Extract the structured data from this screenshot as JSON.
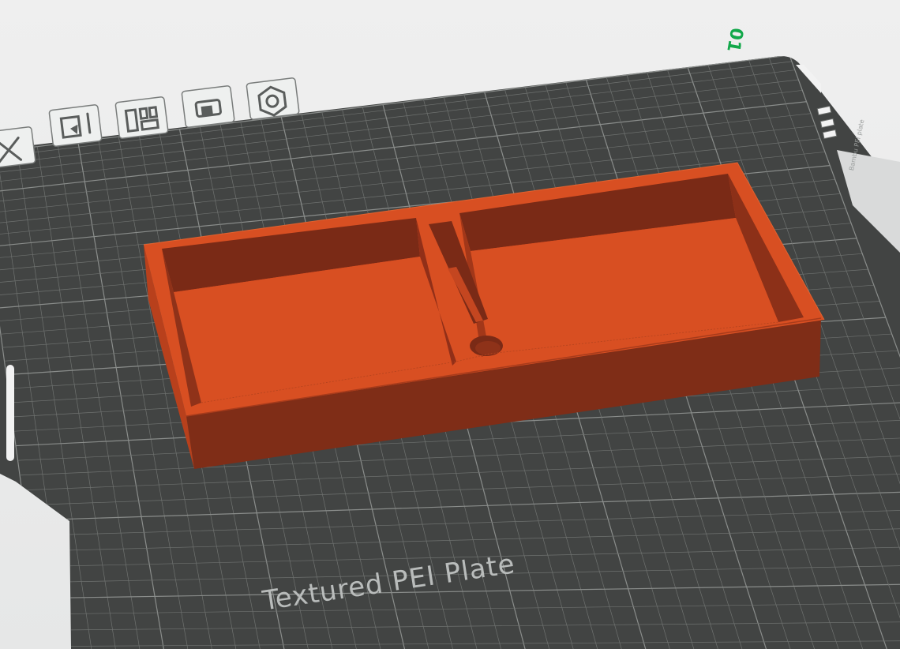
{
  "viewport": {
    "plate_name": "Textured PEI Plate",
    "plate_index": "01",
    "side_tab_text": "Bambu PEI plate"
  },
  "plate_toolbar": [
    {
      "id": "close",
      "label": "Close",
      "icon": "close-icon"
    },
    {
      "id": "select",
      "label": "Select plate",
      "icon": "plate-select-icon"
    },
    {
      "id": "arrange",
      "label": "Arrange",
      "icon": "arrange-icon"
    },
    {
      "id": "lock",
      "label": "Lock",
      "icon": "lock-icon"
    },
    {
      "id": "settings",
      "label": "Plate settings",
      "icon": "settings-hex-icon"
    }
  ],
  "model": {
    "name": "tray",
    "color": "#d84f22",
    "shadow_color": "#7a2a16",
    "dark_color": "#913219"
  },
  "colors": {
    "bed": "#424443",
    "grid_line": "#6f7270",
    "grid_major": "#8a8d8b",
    "background": "#e9eaea",
    "accent": "#12a84a"
  }
}
